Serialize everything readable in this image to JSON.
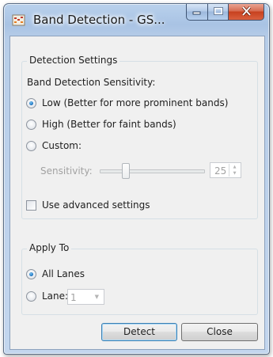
{
  "window": {
    "title": "Band Detection - GS...",
    "icon": "gel-image-icon",
    "caption_buttons": [
      "minimize",
      "maximize",
      "close"
    ]
  },
  "detection_settings": {
    "group_title": "Detection Settings",
    "sensitivity_heading": "Band Detection Sensitivity:",
    "options": [
      {
        "label": "Low (Better for more prominent bands)",
        "checked": true
      },
      {
        "label": "High (Better for faint bands)",
        "checked": false
      },
      {
        "label": "Custom:",
        "checked": false
      }
    ],
    "custom": {
      "sensitivity_label": "Sensitivity:",
      "sensitivity_value": "25",
      "slider_level": 0.25,
      "enabled": false
    },
    "advanced": {
      "label": "Use advanced settings",
      "checked": false
    }
  },
  "apply_to": {
    "group_title": "Apply To",
    "options": [
      {
        "label": "All Lanes",
        "checked": true
      },
      {
        "label": "Lane:",
        "checked": false
      }
    ],
    "lane_value": "1"
  },
  "buttons": {
    "detect": "Detect",
    "close": "Close"
  },
  "colors": {
    "title_bar": "#b0c9e8",
    "close_button": "#c7411f",
    "radio_selected": "#1f78c4"
  }
}
